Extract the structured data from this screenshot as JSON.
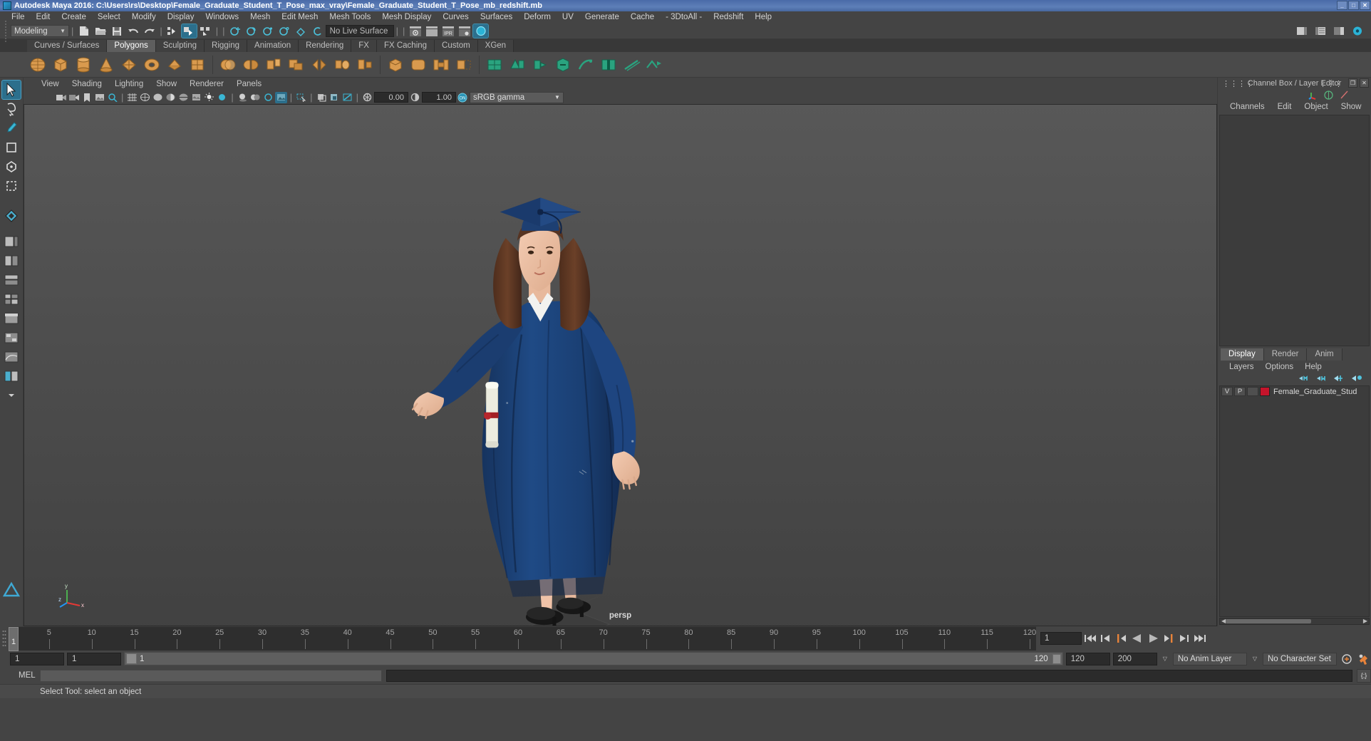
{
  "window": {
    "title": "Autodesk Maya 2016: C:\\Users\\rs\\Desktop\\Female_Graduate_Student_T_Pose_max_vray\\Female_Graduate_Student_T_Pose_mb_redshift.mb",
    "minimize": "_",
    "maximize": "□",
    "close": "✕",
    "titlebar_color": "#5d7fb8"
  },
  "menubar": {
    "items": [
      "File",
      "Edit",
      "Create",
      "Select",
      "Modify",
      "Display",
      "Windows",
      "Mesh",
      "Edit Mesh",
      "Mesh Tools",
      "Mesh Display",
      "Curves",
      "Surfaces",
      "Deform",
      "UV",
      "Generate",
      "Cache",
      "- 3DtoAll -",
      "Redshift",
      "Help"
    ]
  },
  "statusbar": {
    "menu_set": "Modeling",
    "live_surface": "No Live Surface",
    "ipr_label": "IPR"
  },
  "shelf": {
    "tabs": [
      "Curves / Surfaces",
      "Polygons",
      "Sculpting",
      "Rigging",
      "Animation",
      "Rendering",
      "FX",
      "FX Caching",
      "Custom",
      "XGen"
    ],
    "active_tab": "Polygons"
  },
  "viewport": {
    "menus": [
      "View",
      "Shading",
      "Lighting",
      "Show",
      "Renderer",
      "Panels"
    ],
    "exposure": "0.00",
    "gamma_value": "1.00",
    "color_management": "sRGB gamma",
    "cm_toggle": "ON",
    "camera_label": "persp",
    "axis_labels": {
      "x": "x",
      "y": "y",
      "z": "z"
    },
    "bg_top": "#5a5a5a",
    "bg_bottom": "#434343",
    "model": {
      "gown_color": "#1b3f72",
      "gown_shadow": "#15305a",
      "skin_color": "#f0c3a8",
      "hair_color": "#5a3622",
      "shoe_color": "#1a1a1a",
      "scroll_color": "#e8e8e2"
    }
  },
  "channelbox": {
    "title": "Channel Box / Layer Editor",
    "menus": [
      "Channels",
      "Edit",
      "Object",
      "Show"
    ],
    "restore": "❐",
    "close": "✕"
  },
  "layereditor": {
    "tabs": [
      "Display",
      "Render",
      "Anim"
    ],
    "active_tab": "Display",
    "menus": [
      "Layers",
      "Options",
      "Help"
    ],
    "columns": {
      "visibility": "V",
      "playback": "P"
    },
    "layers": [
      {
        "v": "V",
        "p": "P",
        "t": "",
        "color": "#c5142b",
        "name": "Female_Graduate_Stud"
      }
    ]
  },
  "timeslider": {
    "current_frame": "1",
    "tick_labels": [
      "5",
      "10",
      "15",
      "20",
      "25",
      "30",
      "35",
      "40",
      "45",
      "50",
      "55",
      "60",
      "65",
      "70",
      "75",
      "80",
      "85",
      "90",
      "95",
      "100",
      "105",
      "110",
      "115",
      "120"
    ],
    "start": 1,
    "end": 120,
    "playback_field": "1"
  },
  "rangeslider": {
    "anim_start": "1",
    "range_start": "1",
    "range_bar_left": "1",
    "range_bar_right": "120",
    "range_end": "120",
    "anim_end": "200",
    "anim_layer": "No Anim Layer",
    "character_set": "No Character Set"
  },
  "command": {
    "label": "MEL",
    "input_value": "",
    "script_editor_icon": "{;}"
  },
  "status": {
    "message": "Select Tool: select an object"
  }
}
